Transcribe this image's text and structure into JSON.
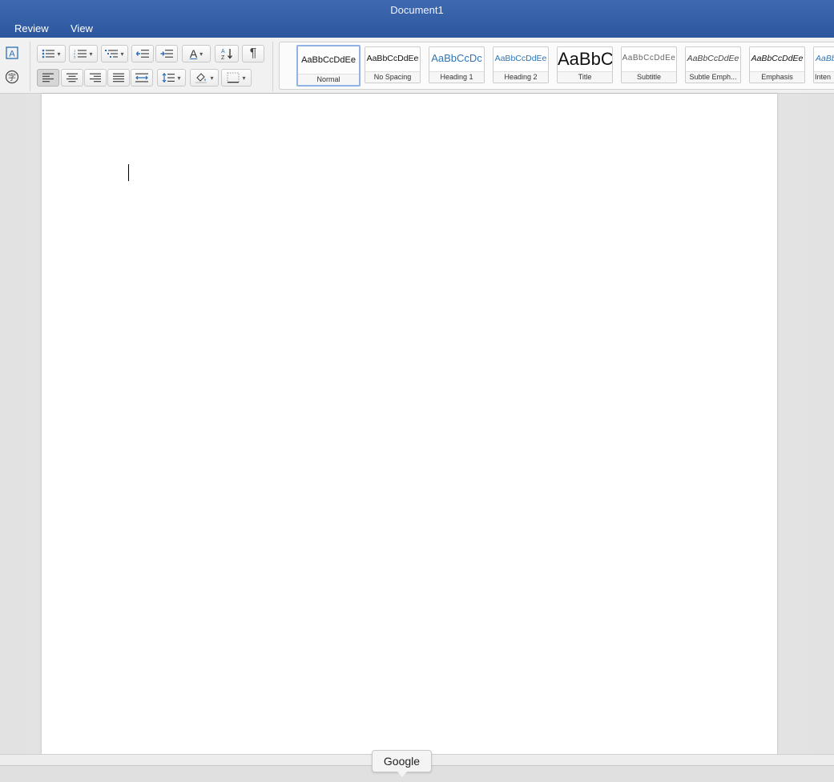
{
  "window": {
    "title": "Document1"
  },
  "menu": {
    "tabs": [
      {
        "label": "Review"
      },
      {
        "label": "View"
      }
    ]
  },
  "ribbon": {
    "paragraph": {
      "bullets_icon": "bulleted-list-icon",
      "numbering_icon": "numbered-list-icon",
      "multilevel_icon": "multilevel-list-icon",
      "sort_label": "A Z",
      "show_marks_glyph": "¶",
      "text_effects_glyph": "A"
    },
    "styles": [
      {
        "sample": "AaBbCcDdEe",
        "name": "Normal",
        "color": "#111111",
        "selected": true
      },
      {
        "sample": "AaBbCcDdEe",
        "name": "No Spacing",
        "color": "#111111"
      },
      {
        "sample": "AaBbCcDc",
        "name": "Heading 1",
        "color": "#2e74b5"
      },
      {
        "sample": "AaBbCcDdEe",
        "name": "Heading 2",
        "color": "#2e74b5"
      },
      {
        "sample": "AaBbC",
        "name": "Title",
        "color": "#111111"
      },
      {
        "sample": "AaBbCcDdEe",
        "name": "Subtitle",
        "color": "#666666"
      },
      {
        "sample": "AaBbCcDdEe",
        "name": "Subtle Emph...",
        "color": "#444444"
      },
      {
        "sample": "AaBbCcDdEe",
        "name": "Emphasis",
        "color": "#111111"
      },
      {
        "sample": "AaBb",
        "name": "Inten",
        "color": "#2e74b5"
      }
    ]
  },
  "document": {
    "body_text": ""
  },
  "dock": {
    "tooltip": "Google"
  },
  "colors": {
    "accent": "#2c579e",
    "selected_style_border": "#8fb3e3"
  }
}
